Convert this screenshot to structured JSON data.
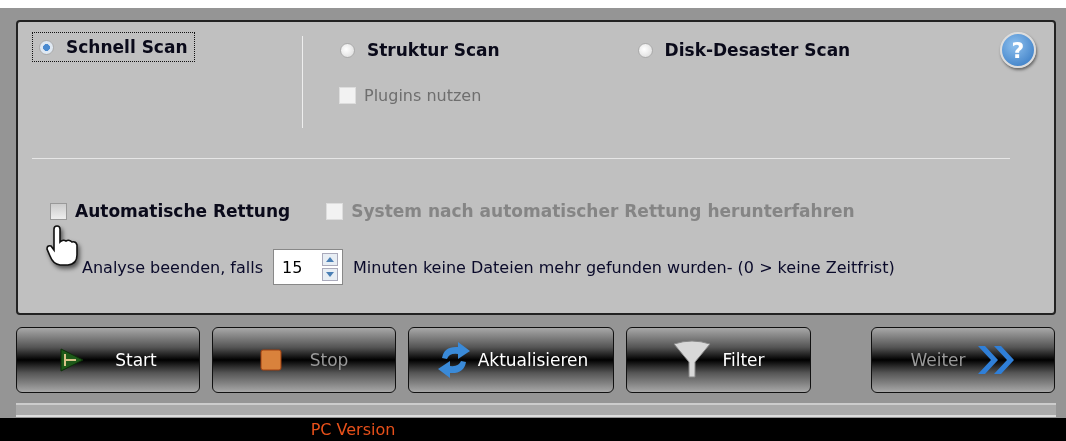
{
  "scan_modes": [
    {
      "label": "Schnell Scan",
      "selected": true
    },
    {
      "label": "Struktur Scan",
      "selected": false
    },
    {
      "label": "Disk-Desaster Scan",
      "selected": false
    }
  ],
  "help_button": {
    "label": "?"
  },
  "plugins": {
    "label": "Plugins nutzen",
    "checked": false,
    "disabled": true
  },
  "auto_rescue": {
    "label": "Automatische Rettung",
    "checked": false,
    "disabled": false
  },
  "shutdown": {
    "label": "System nach automatischer Rettung herunterfahren",
    "checked": false,
    "disabled": true
  },
  "timeout": {
    "prefix": "Analyse beenden, falls",
    "value": "15",
    "suffix": "Minuten keine Dateien mehr gefunden wurden- (0 > keine Zeitfrist)"
  },
  "buttons": [
    {
      "label": "Start",
      "kind": "start",
      "disabled": false
    },
    {
      "label": "Stop",
      "kind": "stop",
      "disabled": true
    },
    {
      "label": "Aktualisieren",
      "kind": "refresh",
      "disabled": false
    },
    {
      "label": "Filter",
      "kind": "filter",
      "disabled": false
    },
    {
      "label": "Weiter",
      "kind": "next",
      "disabled": true
    }
  ],
  "footer": {
    "label": "PC Version"
  }
}
